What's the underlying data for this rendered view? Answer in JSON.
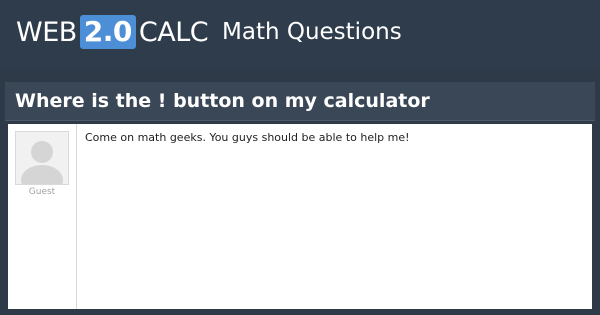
{
  "header": {
    "logo": {
      "prefix": "WEB",
      "badge": "2.0",
      "suffix": "CALC"
    },
    "section": "Math Questions"
  },
  "question": {
    "title": "Where is the ! button on my calculator",
    "author": "Guest",
    "body": "Come on math geeks. You guys should be able to help me!",
    "avatar_icon": "user-silhouette-icon"
  },
  "colors": {
    "background": "#2e3a48",
    "header": "#2f3c4b",
    "title_bar": "#3a4757",
    "badge": "#4c8fd6",
    "post_bg": "#ffffff"
  }
}
